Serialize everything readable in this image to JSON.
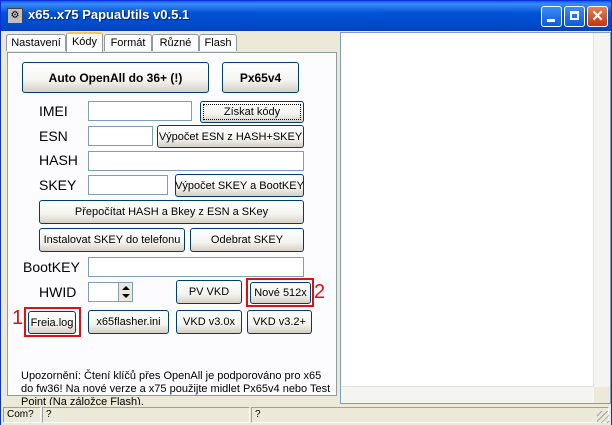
{
  "window": {
    "title": "x65..x75 PapuaUtils v0.5.1"
  },
  "tabs": [
    {
      "label": "Nastavení"
    },
    {
      "label": "Kódy"
    },
    {
      "label": "Formát"
    },
    {
      "label": "Různé"
    },
    {
      "label": "Flash"
    }
  ],
  "active_tab": "Kódy",
  "buttons": {
    "auto_openall": "Auto OpenAll do 36+ (!)",
    "px65v4": "Px65v4",
    "ziskat_kody": "Získat kódy",
    "esn_calc": "Výpočet ESN z HASH+SKEY",
    "skey_calc": "Výpočet SKEY a BootKEY",
    "recalc": "Přepočítat HASH a Bkey z ESN a SKey",
    "install_skey": "Instalovat SKEY do telefonu",
    "remove_skey": "Odebrat SKEY",
    "pv_vkd": "PV VKD",
    "nove_512x": "Nové 512x",
    "freia_log": "Freia.log",
    "x65flasher": "x65flasher.ini",
    "vkd_30": "VKD v3.0x",
    "vkd_32": "VKD v3.2+"
  },
  "labels": {
    "imei": "IMEI",
    "esn": "ESN",
    "hash": "HASH",
    "skey": "SKEY",
    "bootkey": "BootKEY",
    "hwid": "HWID"
  },
  "fields": {
    "imei": "",
    "esn": "",
    "hash": "",
    "skey": "",
    "bootkey": "",
    "hwid": ""
  },
  "annotations": {
    "one": "1",
    "two": "2"
  },
  "note_text": "Upozornění: Čtení klíčů přes OpenAll je podporováno pro x65 do fw36! Na nové verze a x75 použijte midlet Px65v4 nebo Test Point (Na záložce Flash).",
  "statusbar": {
    "pane1": "Com?",
    "pane2": "?",
    "pane3": "?"
  },
  "colors": {
    "title_blue": "#0052d6",
    "annotation_red": "#e01010"
  }
}
